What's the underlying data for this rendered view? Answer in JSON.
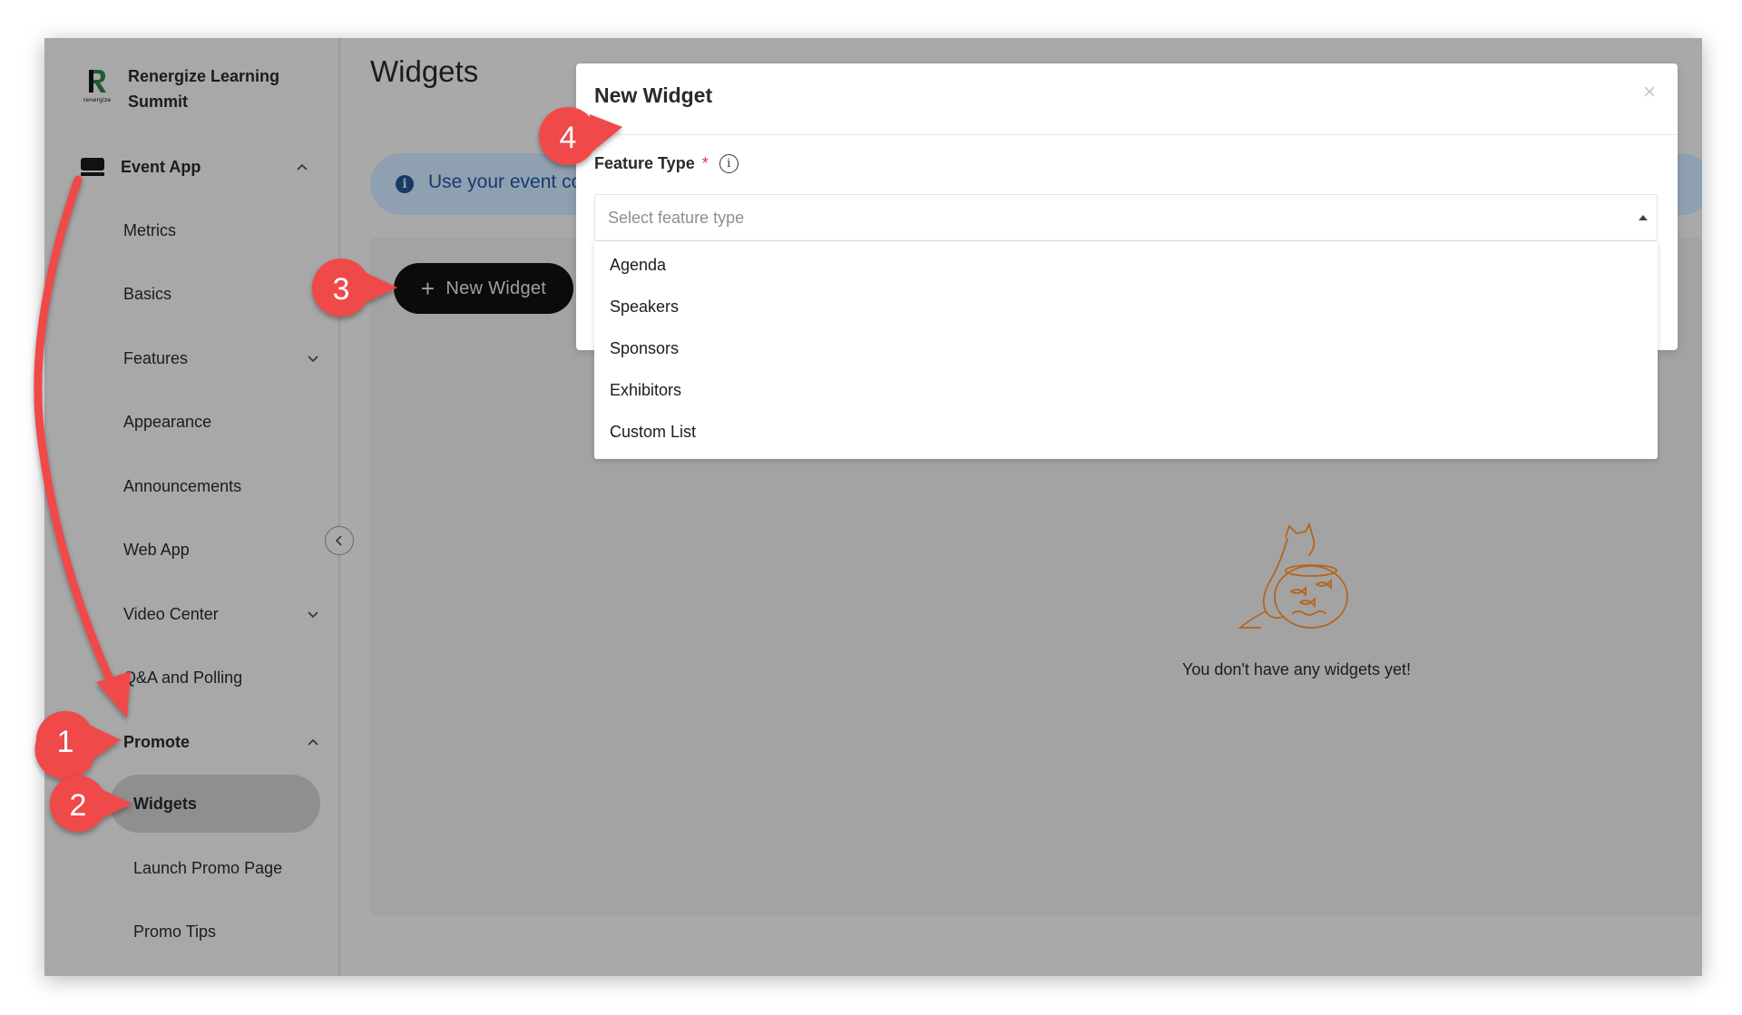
{
  "brand": {
    "name": "Renergize Learning Summit",
    "logo_text": "renergize"
  },
  "sidebar": {
    "groups": [
      {
        "label": "Event App",
        "icon": "event-app-icon",
        "expanded": true
      },
      {
        "label": "Promote",
        "expanded": true
      }
    ],
    "items": [
      {
        "label": "Metrics"
      },
      {
        "label": "Basics"
      },
      {
        "label": "Features",
        "has_submenu": true
      },
      {
        "label": "Appearance"
      },
      {
        "label": "Announcements"
      },
      {
        "label": "Web App"
      },
      {
        "label": "Video Center",
        "has_submenu": true
      },
      {
        "label": "Q&A and Polling"
      }
    ],
    "promote_items": [
      {
        "label": "Widgets",
        "active": true
      },
      {
        "label": "Launch Promo Page"
      },
      {
        "label": "Promo Tips"
      }
    ]
  },
  "main": {
    "title": "Widgets",
    "info_banner": "Use your event co",
    "new_widget_button": "New Widget",
    "empty_state": "You don't have any widgets yet!"
  },
  "modal": {
    "title": "New Widget",
    "close_symbol": "×",
    "field_label": "Feature Type",
    "required_mark": "*",
    "placeholder": "Select feature type",
    "options": [
      "Agenda",
      "Speakers",
      "Sponsors",
      "Exhibitors",
      "Custom List"
    ]
  },
  "annotations": [
    "1",
    "2",
    "3",
    "4"
  ],
  "colors": {
    "annotation_red": "#f04848",
    "info_blue": "#163a70",
    "empty_illustration": "#b5651d"
  }
}
